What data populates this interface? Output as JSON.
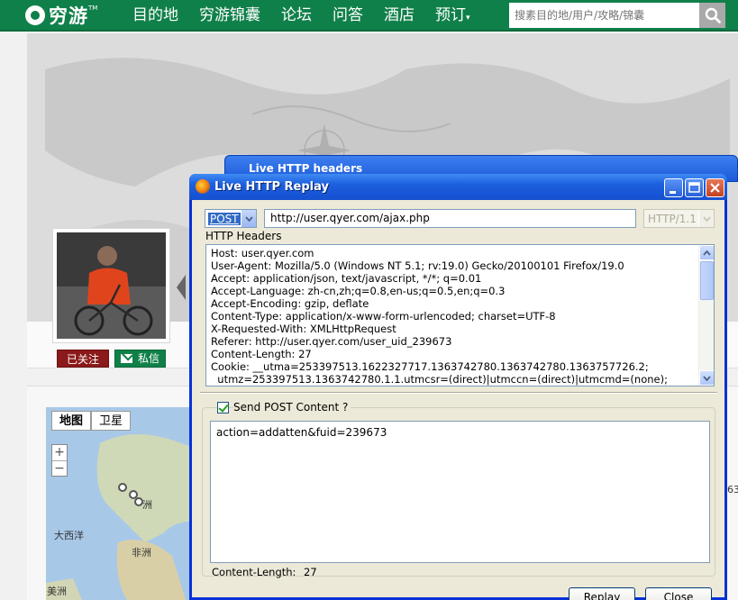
{
  "site": {
    "logo_text": "穷游",
    "logo_tm": "TM",
    "nav": [
      "目的地",
      "穷游锦囊",
      "论坛",
      "问答",
      "酒店",
      "预订"
    ],
    "nav_caret": "▾",
    "search_placeholder": "搜素目的地/用户/攻略/锦囊"
  },
  "profile": {
    "followed_label": "已关注",
    "message_label": "私信"
  },
  "map": {
    "tab_map": "地图",
    "tab_satellite": "卫星",
    "zoom_in": "+",
    "zoom_out": "−",
    "labels": [
      "洲",
      "大西洋",
      "非洲",
      "美洲"
    ]
  },
  "right_fragment": "63",
  "back_window": {
    "title": "Live HTTP headers"
  },
  "dialog": {
    "title": "Live HTTP Replay",
    "method": "POST",
    "url": "http://user.qyer.com/ajax.php",
    "http_version": "HTTP/1.1",
    "headers_label": "HTTP Headers",
    "headers": [
      "Host: user.qyer.com",
      "User-Agent: Mozilla/5.0 (Windows NT 5.1; rv:19.0) Gecko/20100101 Firefox/19.0",
      "Accept: application/json, text/javascript, */*; q=0.01",
      "Accept-Language: zh-cn,zh;q=0.8,en-us;q=0.5,en;q=0.3",
      "Accept-Encoding: gzip, deflate",
      "Content-Type: application/x-www-form-urlencoded; charset=UTF-8",
      "X-Requested-With: XMLHttpRequest",
      "Referer: http://user.qyer.com/user_uid_239673",
      "Content-Length: 27",
      "Cookie: __utma=253397513.1622327717.1363742780.1363742780.1363757726.2;",
      "  utmz=253397513.1363742780.1.1.utmcsr=(direct)|utmccn=(direct)|utmcmd=(none);"
    ],
    "send_post_label": "Send POST Content ?",
    "send_post_checked": true,
    "post_content": "action=addatten&fuid=239673",
    "content_length_label": "Content-Length:",
    "content_length_value": "27",
    "replay_button": "Replay",
    "close_button": "Close"
  }
}
